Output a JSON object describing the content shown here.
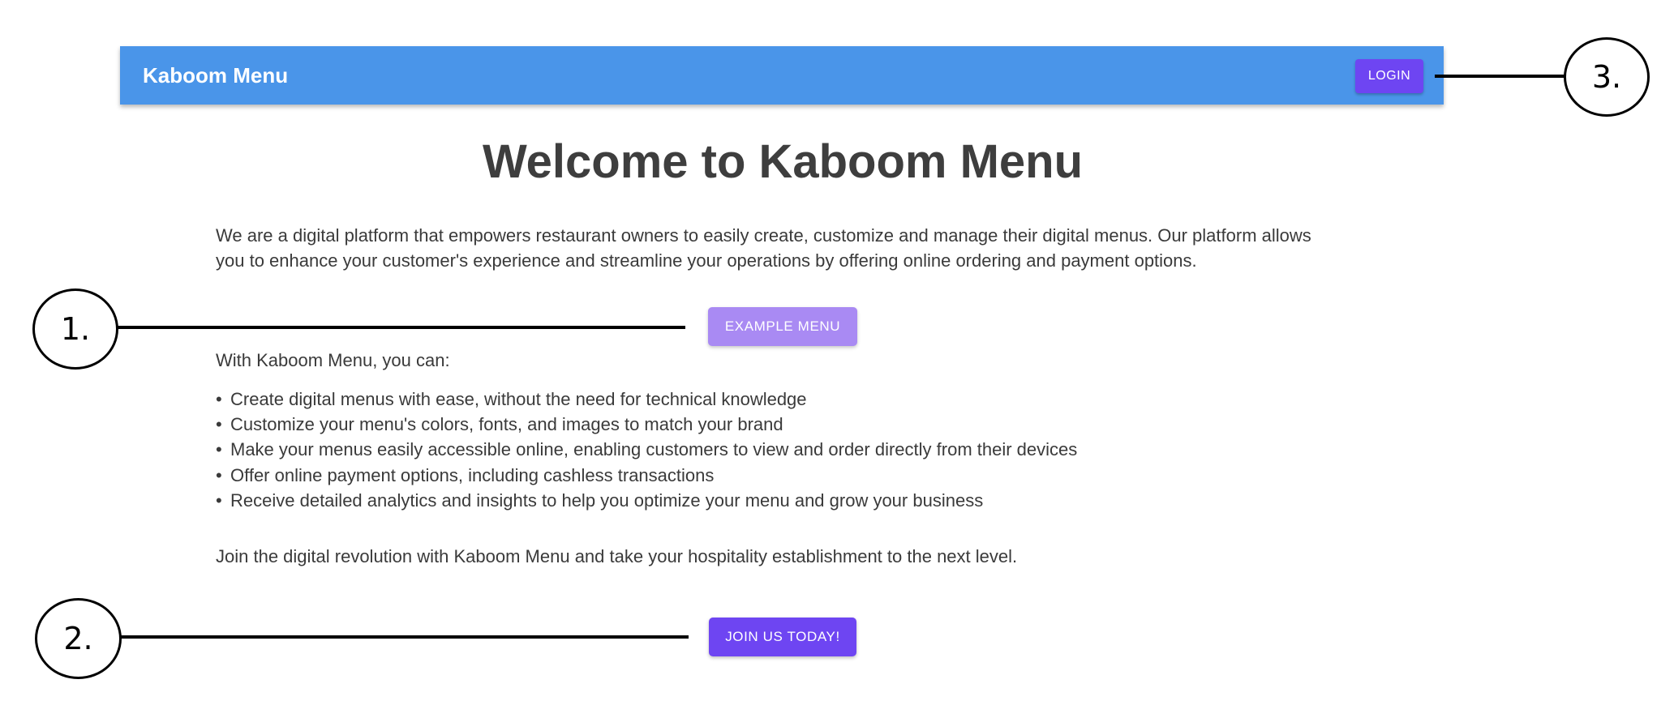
{
  "appbar": {
    "brand": "Kaboom Menu",
    "login_label": "LOGIN"
  },
  "main": {
    "title": "Welcome to Kaboom Menu",
    "intro": "We are a digital platform that empowers restaurant owners to easily create, customize and manage their digital menus. Our platform allows you to enhance your customer's experience and streamline your operations by offering online ordering and payment options.",
    "example_menu_label": "EXAMPLE MENU",
    "lead": "With Kaboom Menu, you can:",
    "features": [
      "Create digital menus with ease, without the need for technical knowledge",
      "Customize your menu's colors, fonts, and images to match your brand",
      "Make your menus easily accessible online, enabling customers to view and order directly from their devices",
      "Offer online payment options, including cashless transactions",
      "Receive detailed analytics and insights to help you optimize your menu and grow your business"
    ],
    "outro": "Join the digital revolution with Kaboom Menu and take your hospitality establishment to the next level.",
    "join_label": "JOIN US TODAY!"
  },
  "callouts": [
    "1.",
    "2.",
    "3."
  ],
  "colors": {
    "appbar": "#4a95e9",
    "primary_button": "#6e45f2",
    "secondary_button": "#a98af3"
  }
}
